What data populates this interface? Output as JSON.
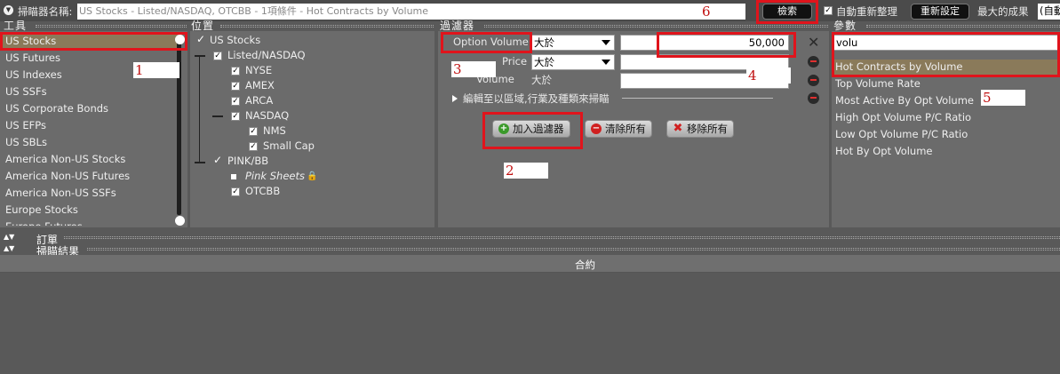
{
  "topbar": {
    "scanner_name_label": "掃瞄器名稱:",
    "scanner_name_value": "US Stocks - Listed/NASDAQ, OTCBB - 1項條件 - Hot Contracts by Volume",
    "search_button": "檢索",
    "auto_refresh_label": "自動重新整理",
    "reset_button": "重新設定",
    "max_results_label": "最大的成果",
    "max_results_value": "(自動"
  },
  "tools": {
    "title": "工具",
    "items": [
      "US Stocks",
      "US Futures",
      "US Indexes",
      "US SSFs",
      "US Corporate Bonds",
      "US EFPs",
      "US SBLs",
      "America Non-US Stocks",
      "America Non-US Futures",
      "America Non-US SSFs",
      "Europe Stocks",
      "Europe Futures"
    ],
    "selected_index": 0
  },
  "location": {
    "title": "位置",
    "root": "US Stocks",
    "listed": "Listed/NASDAQ",
    "nyse": "NYSE",
    "amex": "AMEX",
    "arca": "ARCA",
    "nasdaq": "NASDAQ",
    "nms": "NMS",
    "small_cap": "Small Cap",
    "pink": "PINK/BB",
    "pink_sheets": "Pink Sheets",
    "otcbb": "OTCBB"
  },
  "filters": {
    "title": "過濾器",
    "option_volume_label": "Option Volume",
    "option_volume_op": "大於",
    "option_volume_value": "50,000",
    "price_label": "Price",
    "price_op": "大於",
    "volume_label": "Volume",
    "volume_op": "大於",
    "edit_link": "編輯至以區域,行業及種類來掃瞄",
    "add_button": "加入過濾器",
    "clear_button": "清除所有",
    "remove_button": "移除所有"
  },
  "params": {
    "title": "參數",
    "search_value": "volu",
    "items": [
      "Hot Contracts by Volume",
      "Top Volume Rate",
      "Most Active By Opt Volume",
      "High Opt Volume P/C Ratio",
      "Low Opt Volume P/C Ratio",
      "Hot By Opt Volume"
    ],
    "selected_index": 0
  },
  "bottom": {
    "orders_label": "訂單",
    "results_label": "掃瞄結果",
    "contract_header": "合約"
  },
  "annotations": [
    "1",
    "2",
    "3",
    "4",
    "5",
    "6"
  ],
  "colors": {
    "highlight": "#e0141c",
    "selected_row": "#8a7a5a",
    "background": "#595959",
    "panel": "#6b6b6b"
  }
}
